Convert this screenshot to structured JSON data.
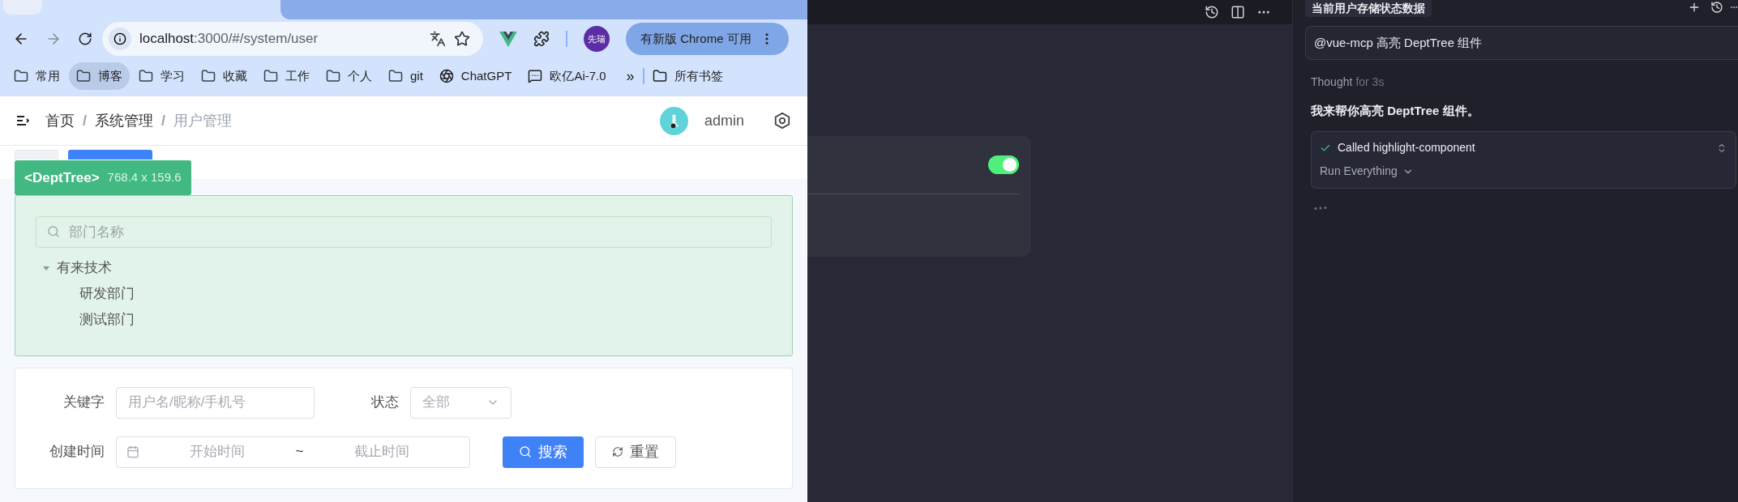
{
  "browser": {
    "address_bar": {
      "host": "localhost",
      "path": ":3000/#/system/user"
    },
    "profile_badge": "先瑞",
    "update_button": "有新版 Chrome 可用",
    "bookmarks": [
      {
        "label": "常用",
        "kind": "folder",
        "selected": false
      },
      {
        "label": "博客",
        "kind": "folder",
        "selected": true
      },
      {
        "label": "学习",
        "kind": "folder",
        "selected": false
      },
      {
        "label": "收藏",
        "kind": "folder",
        "selected": false
      },
      {
        "label": "工作",
        "kind": "folder",
        "selected": false
      },
      {
        "label": "个人",
        "kind": "folder",
        "selected": false
      },
      {
        "label": "git",
        "kind": "folder",
        "selected": false
      },
      {
        "label": "ChatGPT",
        "kind": "chatgpt",
        "selected": false
      },
      {
        "label": "欧亿Ai-7.0",
        "kind": "bot",
        "selected": false
      }
    ],
    "overflow": "»",
    "all_bookmarks": "所有书签"
  },
  "app": {
    "breadcrumb": [
      {
        "label": "首页",
        "current": false,
        "separator": "/"
      },
      {
        "label": "系统管理",
        "current": false,
        "separator": "/"
      },
      {
        "label": "用户管理",
        "current": true
      }
    ],
    "user": "admin",
    "tags": [
      {
        "selected": false
      },
      {
        "selected": true
      }
    ],
    "highlight": {
      "component": "<DeptTree>",
      "size": "768.4 x 159.6"
    },
    "dept_tree": {
      "search_placeholder": "部门名称",
      "nodes": [
        {
          "label": "有来技术",
          "expanded": true,
          "children": [
            {
              "label": "研发部门"
            },
            {
              "label": "测试部门"
            }
          ]
        }
      ]
    },
    "filter": {
      "row_1": [
        {
          "kind": "text",
          "label": "关键字",
          "placeholder": "用户名/昵称/手机号"
        },
        {
          "kind": "select",
          "label": "状态",
          "placeholder": "全部"
        }
      ],
      "date_range": {
        "label": "创建时间",
        "start_placeholder": "开始时间",
        "separator": "~",
        "end_placeholder": "截止时间"
      },
      "buttons": [
        {
          "kind": "primary",
          "label": "搜索"
        },
        {
          "kind": "default",
          "label": "重置"
        }
      ]
    }
  },
  "editor": {
    "toggle": {
      "on": true
    }
  },
  "chat": {
    "title": "当前用户存储状态数据",
    "prompt": "@vue-mcp 高亮 DeptTree 组件",
    "thought": {
      "label": "Thought",
      "duration": "for 3s"
    },
    "reply": "我来帮你高亮 DeptTree 组件。",
    "tool_call": {
      "done": true,
      "label": "Called highlight-component",
      "mode": "Run Everything"
    }
  }
}
